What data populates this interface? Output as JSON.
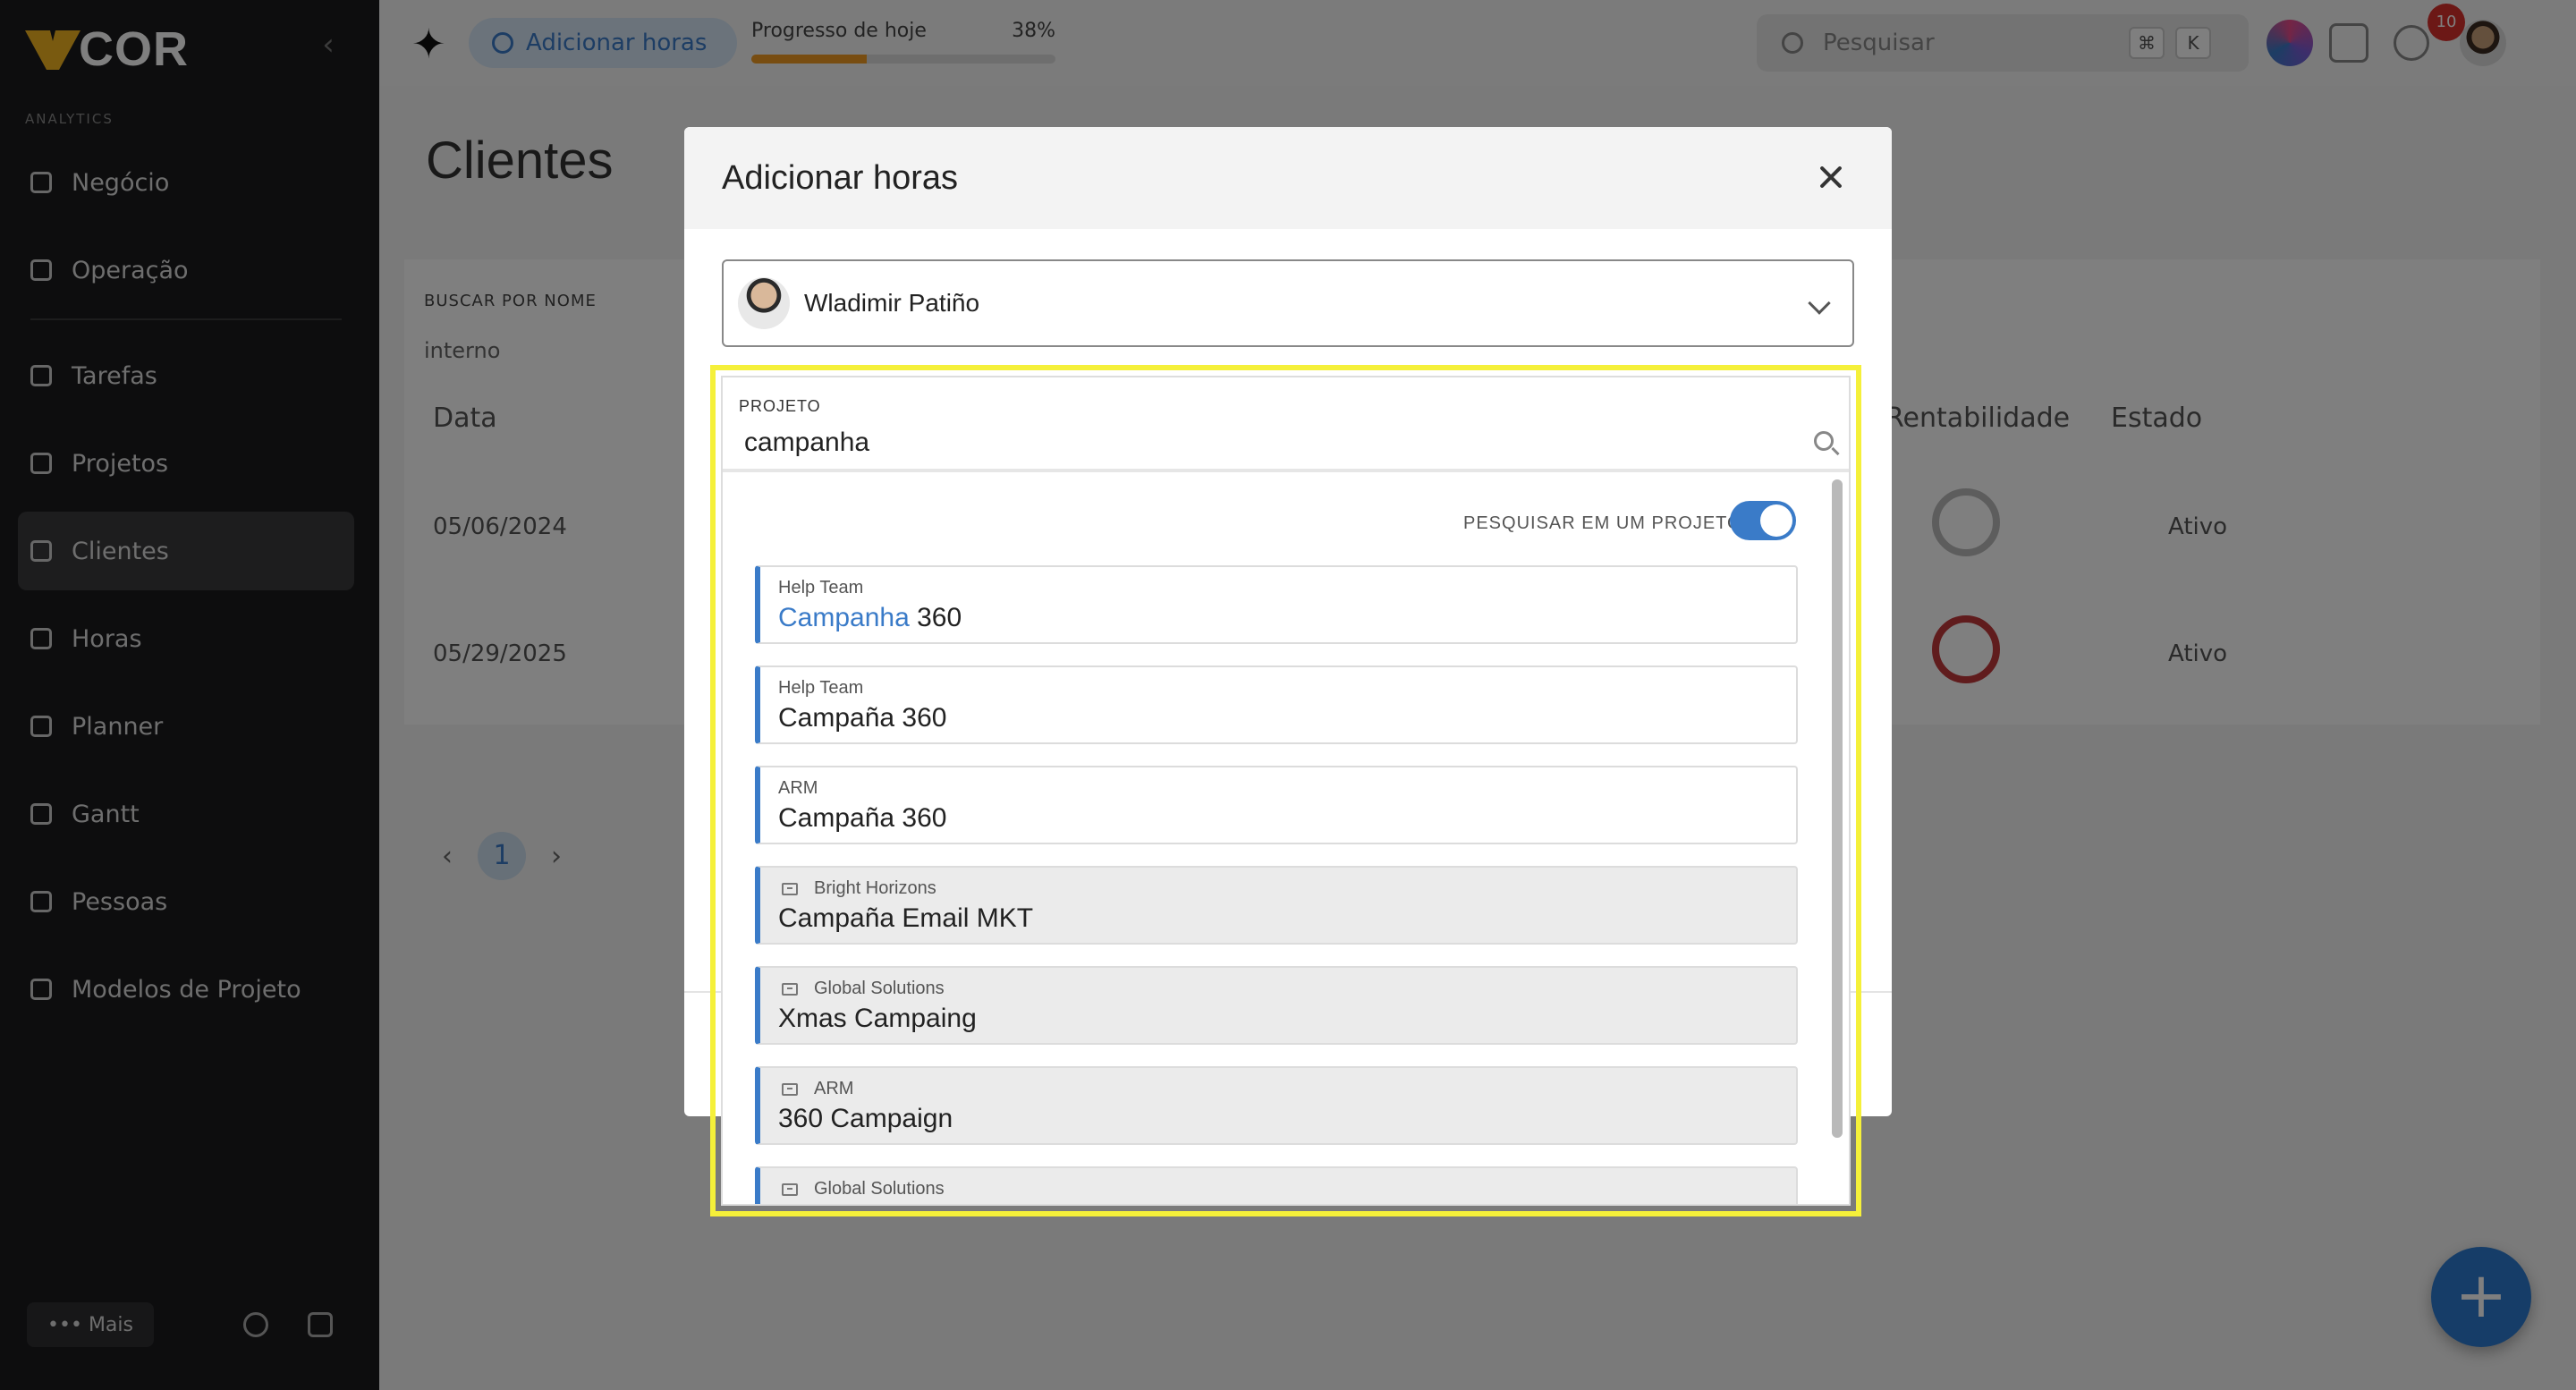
{
  "app": {
    "logo_text": "COR",
    "section_label": "ANALYTICS",
    "collapse_icon": "chevron-left-icon"
  },
  "sidebar": {
    "items": [
      {
        "label": "Negócio",
        "icon": "chart-icon"
      },
      {
        "label": "Operação",
        "icon": "gear-icon"
      },
      {
        "label": "Tarefas",
        "icon": "check-icon"
      },
      {
        "label": "Projetos",
        "icon": "folder-icon"
      },
      {
        "label": "Clientes",
        "icon": "briefcase-icon",
        "active": true
      },
      {
        "label": "Horas",
        "icon": "hourglass-icon"
      },
      {
        "label": "Planner",
        "icon": "calendar-icon"
      },
      {
        "label": "Gantt",
        "icon": "gantt-icon"
      },
      {
        "label": "Pessoas",
        "icon": "people-icon"
      },
      {
        "label": "Modelos de Projeto",
        "icon": "template-icon"
      }
    ],
    "more_label": "••• Mais"
  },
  "topbar": {
    "add_hours_label": "Adicionar horas",
    "progress_label": "Progresso de hoje",
    "progress_value": "38%",
    "progress_fraction": 0.38,
    "search_placeholder": "Pesquisar",
    "kbd1": "⌘",
    "kbd2": "K",
    "notification_count": "10"
  },
  "page": {
    "title": "Clientes",
    "filter_label": "BUSCAR POR NOME",
    "filter_value": "interno",
    "columns": [
      "Data",
      "Rentabilidade",
      "Estado"
    ],
    "rows": [
      {
        "date": "05/06/2024",
        "rentability": "0%",
        "status": "Ativo"
      },
      {
        "date": "05/29/2025",
        "rentability": "100%",
        "status": "Ativo"
      }
    ],
    "current_page": "1"
  },
  "modal": {
    "title": "Adicionar horas",
    "user_name": "Wladimir Patiño",
    "project_field_label": "PROJETO",
    "project_query": "campanha",
    "toggle_label": "PESQUISAR EM UM PROJETO",
    "toggle_on": true,
    "results": [
      {
        "client": "Help Team",
        "name_highlight": "Campanha",
        "name_rest": " 360",
        "archived": false
      },
      {
        "client": "Help Team",
        "name_highlight": "",
        "name_rest": "Campaña 360",
        "archived": false
      },
      {
        "client": "ARM",
        "name_highlight": "",
        "name_rest": "Campaña 360",
        "archived": false
      },
      {
        "client": "Bright Horizons",
        "name_highlight": "",
        "name_rest": "Campaña Email MKT",
        "archived": true
      },
      {
        "client": "Global Solutions",
        "name_highlight": "",
        "name_rest": "Xmas Campaing",
        "archived": true
      },
      {
        "client": "ARM",
        "name_highlight": "",
        "name_rest": "360 Campaign",
        "archived": true
      },
      {
        "client": "Global Solutions",
        "name_highlight": "",
        "name_rest": "",
        "archived": true
      }
    ]
  },
  "colors": {
    "accent": "#3a7bc8",
    "highlight_frame": "#f5f03a",
    "sidebar_bg": "#1b1b1d",
    "progress": "#f09a22"
  }
}
